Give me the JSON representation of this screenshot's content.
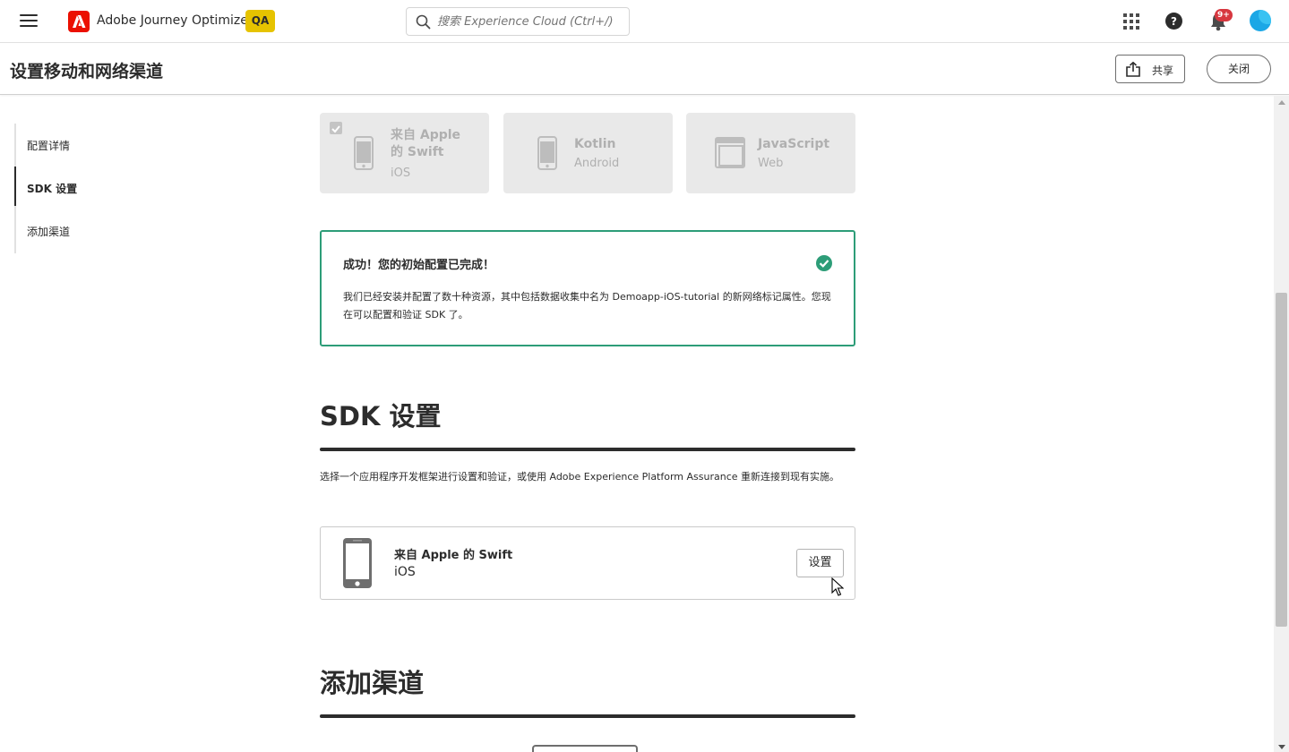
{
  "app": {
    "name": "Adobe Journey Optimizer",
    "env_badge": "QA",
    "search_placeholder": "搜索 Experience Cloud (Ctrl+/)",
    "notification_count": "9+"
  },
  "header": {
    "title": "设置移动和网络渠道",
    "share_label": "共享",
    "close_label": "关闭"
  },
  "sidenav": {
    "items": [
      {
        "label": "配置详情"
      },
      {
        "label": "SDK 设置"
      },
      {
        "label": "添加渠道"
      }
    ]
  },
  "frameworks": [
    {
      "name_line1": "来自 Apple",
      "name_line2": "的 Swift",
      "platform": "iOS",
      "icon": "phone-icon",
      "checked": true
    },
    {
      "name_line1": "Kotlin",
      "platform": "Android",
      "icon": "phone-icon"
    },
    {
      "name_line1": "JavaScript",
      "platform": "Web",
      "icon": "browser-window-icon"
    }
  ],
  "alert": {
    "title": "成功！您的初始配置已完成！",
    "body": "我们已经安装并配置了数十种资源，其中包括数据收集中名为 Demoapp-iOS-tutorial 的新网络标记属性。您现在可以配置和验证 SDK 了。",
    "color": "#2d9d78"
  },
  "sdk_section": {
    "title": "SDK 设置",
    "description": "选择一个应用程序开发框架进行设置和验证，或使用 Adobe Experience Platform Assurance 重新连接到现有实施。",
    "card": {
      "name": "来自 Apple 的 Swift",
      "platform": "iOS",
      "button_label": "设置"
    }
  },
  "channels_section": {
    "title": "添加渠道"
  },
  "colors": {
    "brand": "#eb1000",
    "qa_badge": "#e6c300",
    "notification": "#d7373f"
  }
}
